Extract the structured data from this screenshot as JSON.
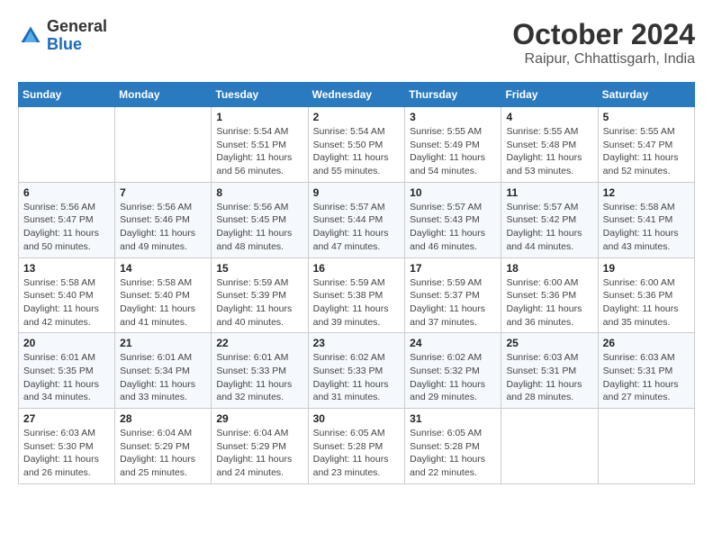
{
  "header": {
    "logo_general": "General",
    "logo_blue": "Blue",
    "month_year": "October 2024",
    "location": "Raipur, Chhattisgarh, India"
  },
  "weekdays": [
    "Sunday",
    "Monday",
    "Tuesday",
    "Wednesday",
    "Thursday",
    "Friday",
    "Saturday"
  ],
  "weeks": [
    [
      {
        "day": "",
        "sunrise": "",
        "sunset": "",
        "daylight": ""
      },
      {
        "day": "",
        "sunrise": "",
        "sunset": "",
        "daylight": ""
      },
      {
        "day": "1",
        "sunrise": "Sunrise: 5:54 AM",
        "sunset": "Sunset: 5:51 PM",
        "daylight": "Daylight: 11 hours and 56 minutes."
      },
      {
        "day": "2",
        "sunrise": "Sunrise: 5:54 AM",
        "sunset": "Sunset: 5:50 PM",
        "daylight": "Daylight: 11 hours and 55 minutes."
      },
      {
        "day": "3",
        "sunrise": "Sunrise: 5:55 AM",
        "sunset": "Sunset: 5:49 PM",
        "daylight": "Daylight: 11 hours and 54 minutes."
      },
      {
        "day": "4",
        "sunrise": "Sunrise: 5:55 AM",
        "sunset": "Sunset: 5:48 PM",
        "daylight": "Daylight: 11 hours and 53 minutes."
      },
      {
        "day": "5",
        "sunrise": "Sunrise: 5:55 AM",
        "sunset": "Sunset: 5:47 PM",
        "daylight": "Daylight: 11 hours and 52 minutes."
      }
    ],
    [
      {
        "day": "6",
        "sunrise": "Sunrise: 5:56 AM",
        "sunset": "Sunset: 5:47 PM",
        "daylight": "Daylight: 11 hours and 50 minutes."
      },
      {
        "day": "7",
        "sunrise": "Sunrise: 5:56 AM",
        "sunset": "Sunset: 5:46 PM",
        "daylight": "Daylight: 11 hours and 49 minutes."
      },
      {
        "day": "8",
        "sunrise": "Sunrise: 5:56 AM",
        "sunset": "Sunset: 5:45 PM",
        "daylight": "Daylight: 11 hours and 48 minutes."
      },
      {
        "day": "9",
        "sunrise": "Sunrise: 5:57 AM",
        "sunset": "Sunset: 5:44 PM",
        "daylight": "Daylight: 11 hours and 47 minutes."
      },
      {
        "day": "10",
        "sunrise": "Sunrise: 5:57 AM",
        "sunset": "Sunset: 5:43 PM",
        "daylight": "Daylight: 11 hours and 46 minutes."
      },
      {
        "day": "11",
        "sunrise": "Sunrise: 5:57 AM",
        "sunset": "Sunset: 5:42 PM",
        "daylight": "Daylight: 11 hours and 44 minutes."
      },
      {
        "day": "12",
        "sunrise": "Sunrise: 5:58 AM",
        "sunset": "Sunset: 5:41 PM",
        "daylight": "Daylight: 11 hours and 43 minutes."
      }
    ],
    [
      {
        "day": "13",
        "sunrise": "Sunrise: 5:58 AM",
        "sunset": "Sunset: 5:40 PM",
        "daylight": "Daylight: 11 hours and 42 minutes."
      },
      {
        "day": "14",
        "sunrise": "Sunrise: 5:58 AM",
        "sunset": "Sunset: 5:40 PM",
        "daylight": "Daylight: 11 hours and 41 minutes."
      },
      {
        "day": "15",
        "sunrise": "Sunrise: 5:59 AM",
        "sunset": "Sunset: 5:39 PM",
        "daylight": "Daylight: 11 hours and 40 minutes."
      },
      {
        "day": "16",
        "sunrise": "Sunrise: 5:59 AM",
        "sunset": "Sunset: 5:38 PM",
        "daylight": "Daylight: 11 hours and 39 minutes."
      },
      {
        "day": "17",
        "sunrise": "Sunrise: 5:59 AM",
        "sunset": "Sunset: 5:37 PM",
        "daylight": "Daylight: 11 hours and 37 minutes."
      },
      {
        "day": "18",
        "sunrise": "Sunrise: 6:00 AM",
        "sunset": "Sunset: 5:36 PM",
        "daylight": "Daylight: 11 hours and 36 minutes."
      },
      {
        "day": "19",
        "sunrise": "Sunrise: 6:00 AM",
        "sunset": "Sunset: 5:36 PM",
        "daylight": "Daylight: 11 hours and 35 minutes."
      }
    ],
    [
      {
        "day": "20",
        "sunrise": "Sunrise: 6:01 AM",
        "sunset": "Sunset: 5:35 PM",
        "daylight": "Daylight: 11 hours and 34 minutes."
      },
      {
        "day": "21",
        "sunrise": "Sunrise: 6:01 AM",
        "sunset": "Sunset: 5:34 PM",
        "daylight": "Daylight: 11 hours and 33 minutes."
      },
      {
        "day": "22",
        "sunrise": "Sunrise: 6:01 AM",
        "sunset": "Sunset: 5:33 PM",
        "daylight": "Daylight: 11 hours and 32 minutes."
      },
      {
        "day": "23",
        "sunrise": "Sunrise: 6:02 AM",
        "sunset": "Sunset: 5:33 PM",
        "daylight": "Daylight: 11 hours and 31 minutes."
      },
      {
        "day": "24",
        "sunrise": "Sunrise: 6:02 AM",
        "sunset": "Sunset: 5:32 PM",
        "daylight": "Daylight: 11 hours and 29 minutes."
      },
      {
        "day": "25",
        "sunrise": "Sunrise: 6:03 AM",
        "sunset": "Sunset: 5:31 PM",
        "daylight": "Daylight: 11 hours and 28 minutes."
      },
      {
        "day": "26",
        "sunrise": "Sunrise: 6:03 AM",
        "sunset": "Sunset: 5:31 PM",
        "daylight": "Daylight: 11 hours and 27 minutes."
      }
    ],
    [
      {
        "day": "27",
        "sunrise": "Sunrise: 6:03 AM",
        "sunset": "Sunset: 5:30 PM",
        "daylight": "Daylight: 11 hours and 26 minutes."
      },
      {
        "day": "28",
        "sunrise": "Sunrise: 6:04 AM",
        "sunset": "Sunset: 5:29 PM",
        "daylight": "Daylight: 11 hours and 25 minutes."
      },
      {
        "day": "29",
        "sunrise": "Sunrise: 6:04 AM",
        "sunset": "Sunset: 5:29 PM",
        "daylight": "Daylight: 11 hours and 24 minutes."
      },
      {
        "day": "30",
        "sunrise": "Sunrise: 6:05 AM",
        "sunset": "Sunset: 5:28 PM",
        "daylight": "Daylight: 11 hours and 23 minutes."
      },
      {
        "day": "31",
        "sunrise": "Sunrise: 6:05 AM",
        "sunset": "Sunset: 5:28 PM",
        "daylight": "Daylight: 11 hours and 22 minutes."
      },
      {
        "day": "",
        "sunrise": "",
        "sunset": "",
        "daylight": ""
      },
      {
        "day": "",
        "sunrise": "",
        "sunset": "",
        "daylight": ""
      }
    ]
  ]
}
